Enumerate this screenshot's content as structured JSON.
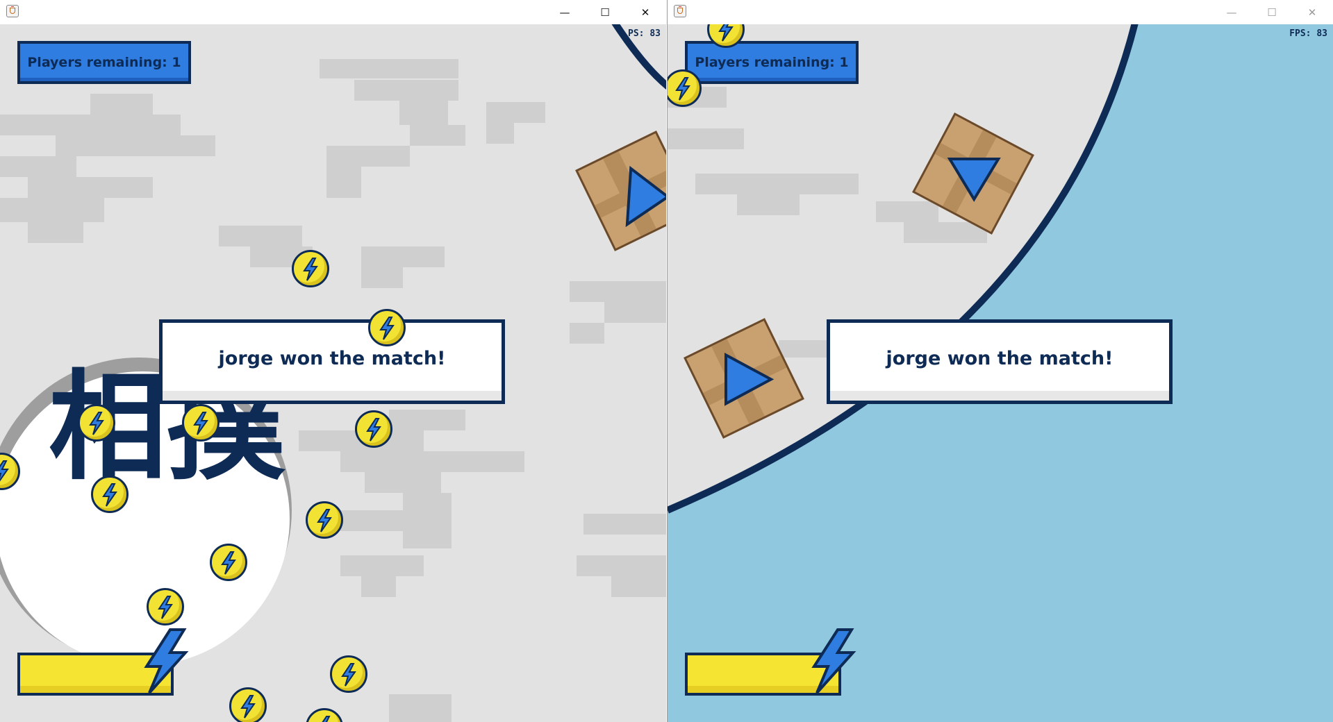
{
  "windows": [
    {
      "id": "left",
      "hud": {
        "players_remaining": "Players remaining: 1",
        "fps": "PS: 83",
        "message": "jorge won the match!",
        "energy_level": 0.8
      },
      "arena": {
        "floor_color": "#e2e2e2",
        "pattern_color": "#cfcfcf",
        "ring_color": "#0e2b55",
        "logo_text": "相撲",
        "coin_count": 15,
        "crate_count": 1
      },
      "titlebar": {
        "minimize": "—",
        "maximize": "☐",
        "close": "✕"
      }
    },
    {
      "id": "right",
      "hud": {
        "players_remaining": "Players remaining: 1",
        "fps": "FPS: 83",
        "message": "jorge won the match!",
        "energy_level": 0.8
      },
      "arena": {
        "floor_color": "#e2e2e2",
        "water_color": "#90c9df",
        "ring_color": "#0e2b55",
        "coin_count": 2,
        "crate_count": 2
      },
      "titlebar": {
        "minimize": "—",
        "maximize": "☐",
        "close": "✕"
      }
    }
  ],
  "colors": {
    "accent_blue": "#2f7de1",
    "navy": "#0e2b55",
    "energy_yellow": "#f5e431",
    "crate_brown": "#c9a170"
  },
  "icons": {
    "coin": "lightning-coin-icon",
    "energy": "lightning-bolt-icon",
    "player": "blue-triangle-player-icon",
    "crate": "cardboard-crate-icon"
  }
}
